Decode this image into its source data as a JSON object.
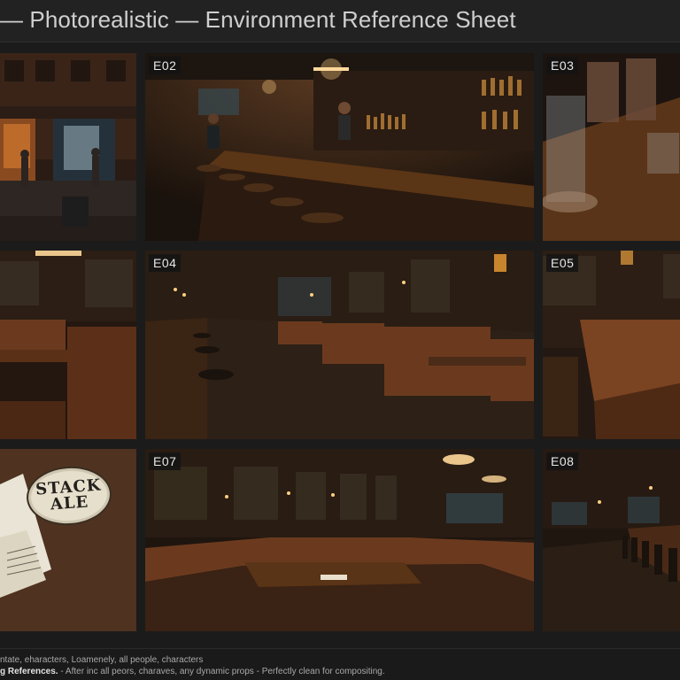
{
  "header": {
    "title": "— Photorealistic — Environment Reference Sheet"
  },
  "tiles": {
    "e01": {
      "label": ""
    },
    "e02": {
      "label": "E02"
    },
    "e03": {
      "label": "E03"
    },
    "e04": {
      "label": "E04"
    },
    "e05": {
      "label": "E05"
    },
    "e06": {
      "label": ""
    },
    "e07": {
      "label": "E07"
    },
    "e08": {
      "label": "E08"
    },
    "e09": {
      "label": ""
    }
  },
  "coaster": {
    "line1": "STACK",
    "line2": "ALE"
  },
  "footer": {
    "line1": "ntate, eharacters, Loamenely, all people, characters",
    "line2_bold": "g References.",
    "line2_rest": " - After inc all peors, charaves, any dynamic props - Perfectly clean for compositing."
  },
  "colors": {
    "background": "#1b1b1b",
    "wood": "#4a2c18",
    "leather": "#6b3a1e",
    "lamp": "#ffcf80"
  }
}
